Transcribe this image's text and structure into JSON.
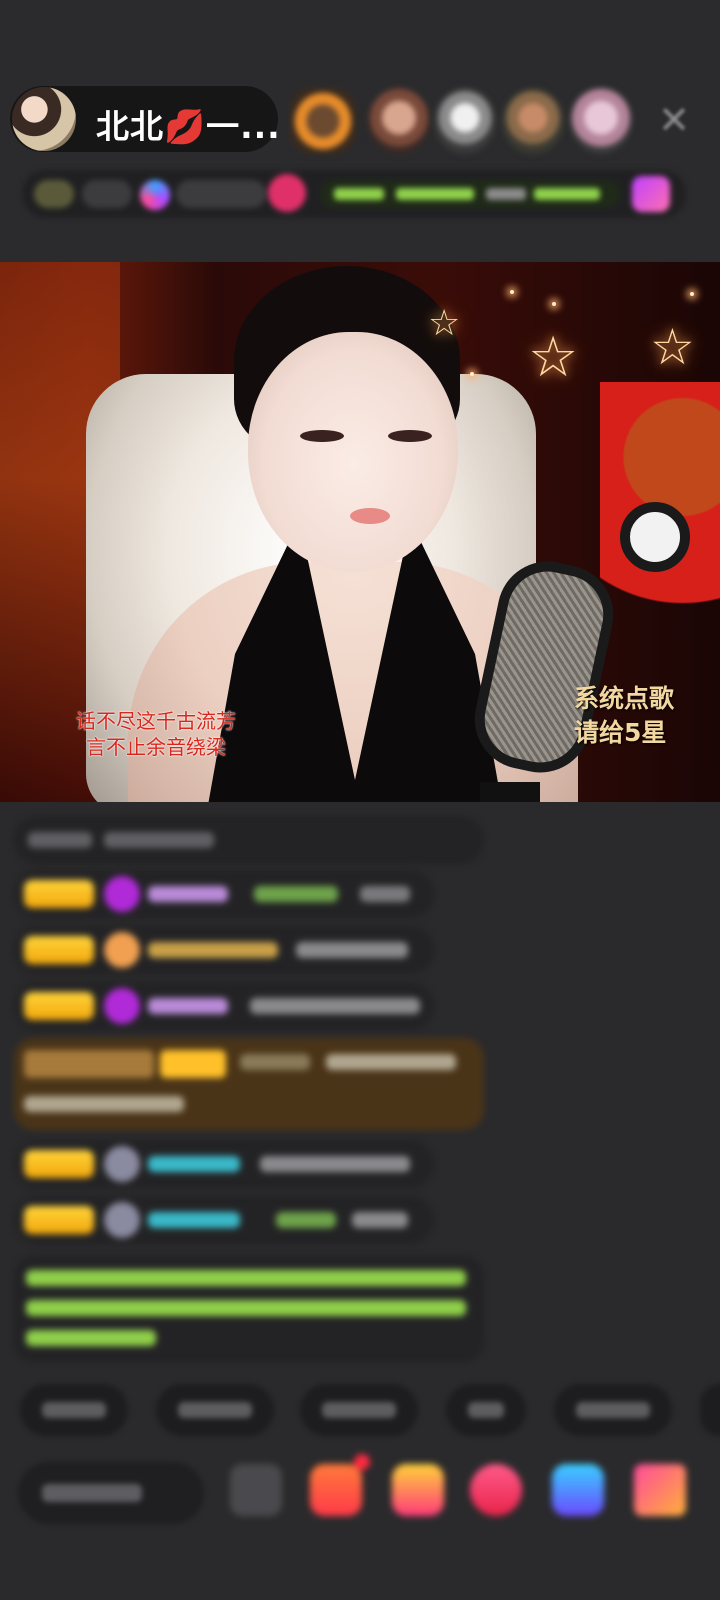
{
  "header": {
    "host_name": "北北💋一...",
    "close_icon": "✕"
  },
  "video": {
    "caption_left_line1": "话不尽这千古流芳",
    "caption_left_line2": "言不止余音绕梁",
    "caption_right_line1": "系统点歌",
    "caption_right_line2": "请给5星"
  },
  "colors": {
    "background": "#2a2a2c",
    "level_badge": "#ffd43a",
    "chat_green": "#8fcf4a",
    "caption_red": "#d8281e",
    "caption_gold": "#f3d7a0"
  }
}
